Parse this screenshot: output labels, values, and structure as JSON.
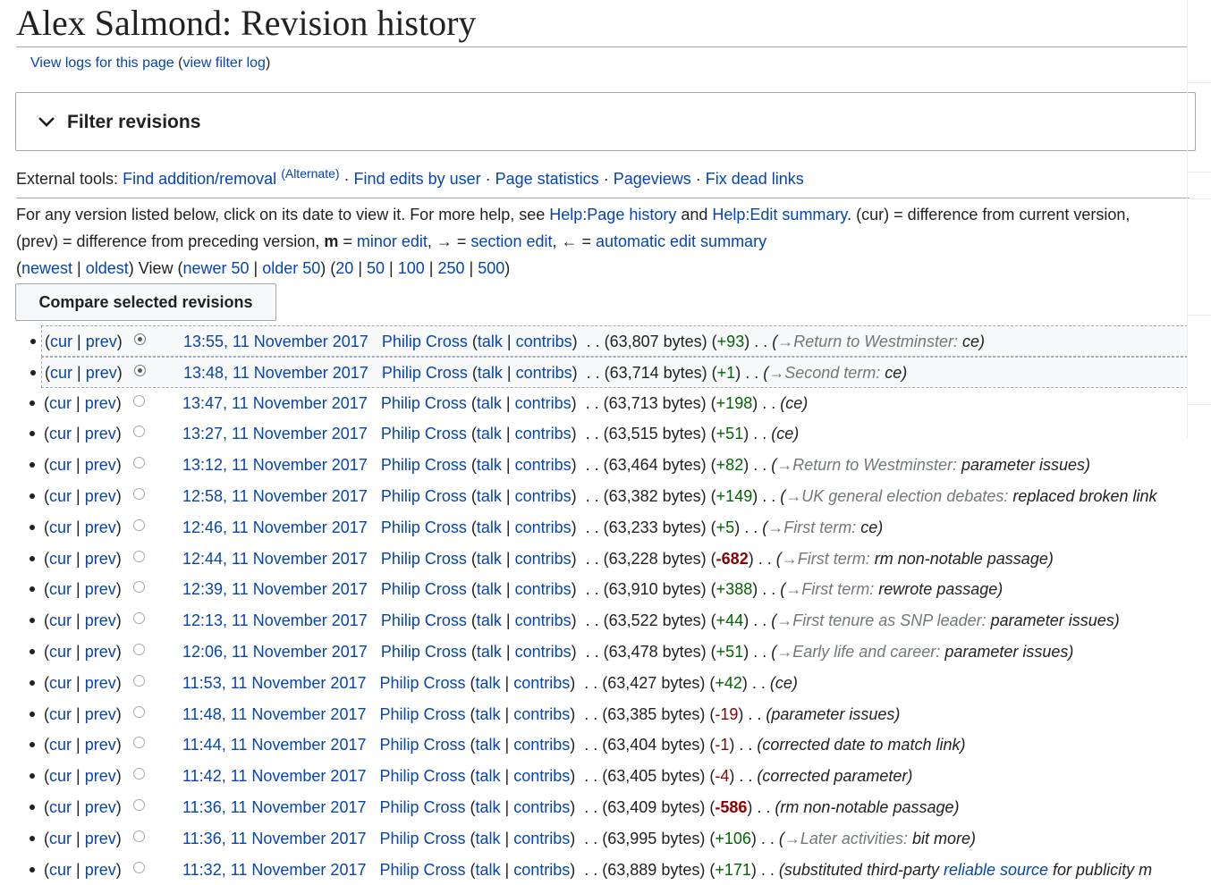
{
  "page": {
    "title": "Alex Salmond: Revision history",
    "logs_link": "View logs for this page",
    "filter_log_link": "view filter log"
  },
  "filter": {
    "label": "Filter revisions"
  },
  "external_tools": {
    "label": "External tools:",
    "items": [
      "Find addition/removal",
      "Find edits by user",
      "Page statistics",
      "Pageviews",
      "Fix dead links"
    ],
    "alternate": "(Alternate)"
  },
  "help": {
    "line1_prefix": "For any version listed below, click on its date to view it. For more help, see ",
    "page_history": "Help:Page history",
    "and": " and ",
    "edit_summary": "Help:Edit summary",
    "line1_suffix": ". (cur) = difference from current version,",
    "line2_prefix": "(prev) = difference from preceding version, ",
    "minor_m": "m",
    "eq": " = ",
    "minor_edit": "minor edit",
    "arrow_section": ", → = ",
    "section_edit": "section edit",
    "arrow_auto": ", ← = ",
    "auto_summary": "automatic edit summary"
  },
  "nav": {
    "newest": "newest",
    "oldest": "oldest",
    "view": ") View (",
    "newer": "newer 50",
    "older": "older 50",
    "limits": [
      "20",
      "50",
      "100",
      "250",
      "500"
    ]
  },
  "compare_button": "Compare selected revisions",
  "colors": {
    "link": "#0645ad",
    "positive": "#006400",
    "negative": "#8b0000"
  },
  "revisions": [
    {
      "date": "13:55, 11 November 2017",
      "user": "Philip Cross",
      "bytes": "(63,807 bytes)",
      "diff": "+93",
      "section": "→Return to Westminster:",
      "summary": "ce)",
      "radio": "on"
    },
    {
      "date": "13:48, 11 November 2017",
      "user": "Philip Cross",
      "bytes": "(63,714 bytes)",
      "diff": "+1",
      "section": "→Second term:",
      "summary": "ce)",
      "radio": "on"
    },
    {
      "date": "13:47, 11 November 2017",
      "user": "Philip Cross",
      "bytes": "(63,713 bytes)",
      "diff": "+198",
      "section": "",
      "summary": "(ce)",
      "radio": "off"
    },
    {
      "date": "13:27, 11 November 2017",
      "user": "Philip Cross",
      "bytes": "(63,515 bytes)",
      "diff": "+51",
      "section": "",
      "summary": "(ce)",
      "radio": "off"
    },
    {
      "date": "13:12, 11 November 2017",
      "user": "Philip Cross",
      "bytes": "(63,464 bytes)",
      "diff": "+82",
      "section": "→Return to Westminster:",
      "summary": "parameter issues)",
      "radio": "off"
    },
    {
      "date": "12:58, 11 November 2017",
      "user": "Philip Cross",
      "bytes": "(63,382 bytes)",
      "diff": "+149",
      "section": "→UK general election debates:",
      "summary": "replaced broken link",
      "radio": "off"
    },
    {
      "date": "12:46, 11 November 2017",
      "user": "Philip Cross",
      "bytes": "(63,233 bytes)",
      "diff": "+5",
      "section": "→First term:",
      "summary": "ce)",
      "radio": "off"
    },
    {
      "date": "12:44, 11 November 2017",
      "user": "Philip Cross",
      "bytes": "(63,228 bytes)",
      "diff": "-682",
      "section": "→First term:",
      "summary": "rm non-notable passage)",
      "radio": "off",
      "big": true
    },
    {
      "date": "12:39, 11 November 2017",
      "user": "Philip Cross",
      "bytes": "(63,910 bytes)",
      "diff": "+388",
      "section": "→First term:",
      "summary": "rewrote passage)",
      "radio": "off"
    },
    {
      "date": "12:13, 11 November 2017",
      "user": "Philip Cross",
      "bytes": "(63,522 bytes)",
      "diff": "+44",
      "section": "→First tenure as SNP leader:",
      "summary": "parameter issues)",
      "radio": "off"
    },
    {
      "date": "12:06, 11 November 2017",
      "user": "Philip Cross",
      "bytes": "(63,478 bytes)",
      "diff": "+51",
      "section": "→Early life and career:",
      "summary": "parameter issues)",
      "radio": "off"
    },
    {
      "date": "11:53, 11 November 2017",
      "user": "Philip Cross",
      "bytes": "(63,427 bytes)",
      "diff": "+42",
      "section": "",
      "summary": "(ce)",
      "radio": "off"
    },
    {
      "date": "11:48, 11 November 2017",
      "user": "Philip Cross",
      "bytes": "(63,385 bytes)",
      "diff": "-19",
      "section": "",
      "summary": "(parameter issues)",
      "radio": "off"
    },
    {
      "date": "11:44, 11 November 2017",
      "user": "Philip Cross",
      "bytes": "(63,404 bytes)",
      "diff": "-1",
      "section": "",
      "summary": "(corrected date to match link)",
      "radio": "off"
    },
    {
      "date": "11:42, 11 November 2017",
      "user": "Philip Cross",
      "bytes": "(63,405 bytes)",
      "diff": "-4",
      "section": "",
      "summary": "(corrected parameter)",
      "radio": "off"
    },
    {
      "date": "11:36, 11 November 2017",
      "user": "Philip Cross",
      "bytes": "(63,409 bytes)",
      "diff": "-586",
      "section": "",
      "summary": "(rm non-notable passage)",
      "radio": "off",
      "big": true
    },
    {
      "date": "11:36, 11 November 2017",
      "user": "Philip Cross",
      "bytes": "(63,995 bytes)",
      "diff": "+106",
      "section": "→Later activities:",
      "summary": "bit more)",
      "radio": "off"
    },
    {
      "date": "11:32, 11 November 2017",
      "user": "Philip Cross",
      "bytes": "(63,889 bytes)",
      "diff": "+171",
      "section": "",
      "summary": "(substituted third-party ",
      "summary_link": "reliable source",
      "summary_tail": " for publicity m",
      "radio": "off"
    }
  ]
}
